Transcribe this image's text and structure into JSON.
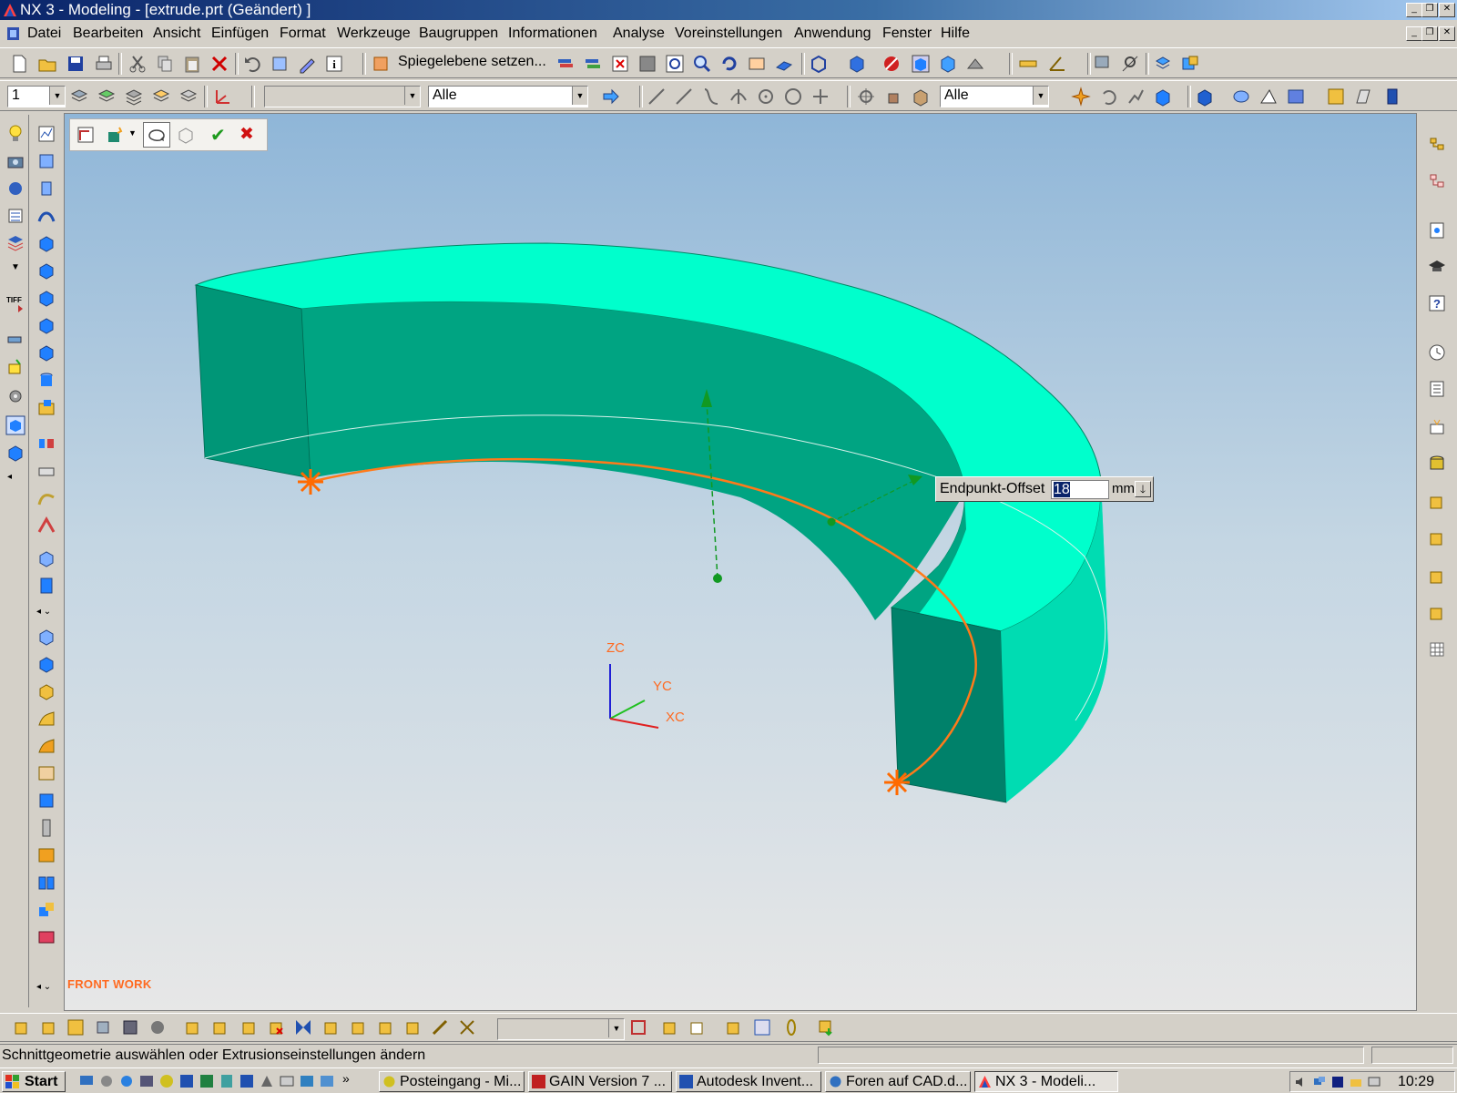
{
  "window": {
    "title": "NX 3 - Modeling - [extrude.prt (Geändert) ]"
  },
  "menu": [
    "Datei",
    "Bearbeiten",
    "Ansicht",
    "Einfügen",
    "Format",
    "Werkzeuge",
    "Baugruppen",
    "Informationen",
    "Analyse",
    "Voreinstellungen",
    "Anwendung",
    "Fenster",
    "Hilfe"
  ],
  "toolbar1": {
    "mirror_label": "Spiegelebene setzen..."
  },
  "toolbar2": {
    "layer_value": "1",
    "filter1_value": "Alle",
    "filter2_value": "Alle"
  },
  "dialog_bar": {
    "ok_label": "✔",
    "cancel_label": "✖"
  },
  "viewport": {
    "view_label": "FRONT WORK",
    "axis_labels": {
      "z": "ZC",
      "y": "YC",
      "x": "XC"
    },
    "offset_box": {
      "label": "Endpunkt-Offset",
      "value": "18",
      "unit": "mm"
    },
    "colors": {
      "face_light": "#00ffcc",
      "face_dark": "#00816a",
      "curve": "#ff7a1a",
      "vector": "#119922"
    }
  },
  "statusbar": {
    "prompt": "Schnittgeometrie auswählen oder Extrusionseinstellungen ändern"
  },
  "taskbar": {
    "start_label": "Start",
    "tasks": [
      "Posteingang - Mi...",
      "GAIN Version 7 ...",
      "Autodesk Invent...",
      "Foren auf CAD.d...",
      "NX 3 - Modeli..."
    ],
    "time": "10:29"
  }
}
